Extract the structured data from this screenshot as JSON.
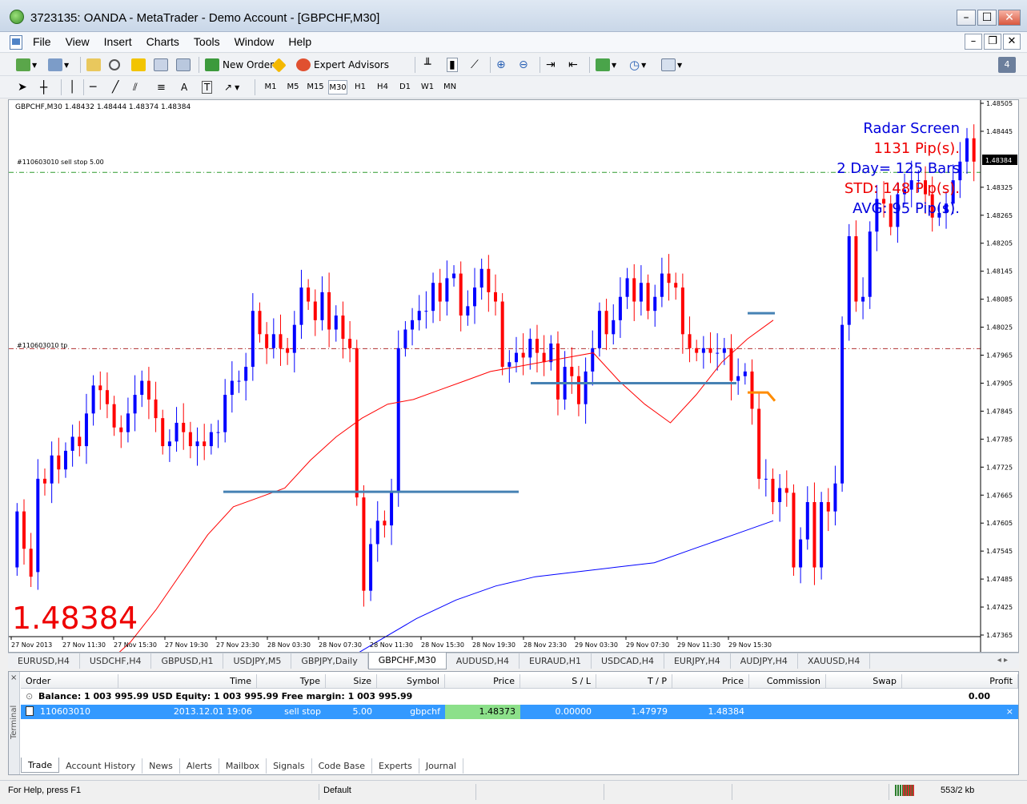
{
  "window": {
    "title": "3723135: OANDA - MetaTrader - Demo Account - [GBPCHF,M30]"
  },
  "menu": [
    "File",
    "View",
    "Insert",
    "Charts",
    "Tools",
    "Window",
    "Help"
  ],
  "toolbar": {
    "new_order": "New Order",
    "expert_advisors": "Expert Advisors",
    "notify_count": "4",
    "draw_text_tool": "A",
    "timeframes": [
      "M1",
      "M5",
      "M15",
      "M30",
      "H1",
      "H4",
      "D1",
      "W1",
      "MN"
    ],
    "active_timeframe": "M30"
  },
  "chart": {
    "header": "GBPCHF,M30  1.48432 1.48444 1.48374 1.48384",
    "price_big": "1.48384",
    "current_price_label": "1.48384",
    "order_line_label": "#110603010 sell stop 5.00",
    "tp_line_label": "#110603010 tp",
    "radar": {
      "title": "Radar Screen",
      "pips": "1131 Pip(s).",
      "bars": "2 Day= 125 Bars",
      "std": "STD: 148 Pip(s).",
      "avg": "AVG: 95 Pip(s)."
    },
    "colors": {
      "bull": "#0000ff",
      "bear": "#ff0000",
      "ma_fast": "#ff0000",
      "ma_slow": "#0000ff",
      "level": "#4682b4",
      "orange": "#ff8c00"
    }
  },
  "chart_data": {
    "type": "candlestick",
    "symbol": "GBPCHF",
    "timeframe": "M30",
    "ylim": [
      1.47365,
      1.48505
    ],
    "y_ticks": [
      "1.48505",
      "1.48445",
      "1.48325",
      "1.48265",
      "1.48205",
      "1.48145",
      "1.48085",
      "1.48025",
      "1.47965",
      "1.47905",
      "1.47845",
      "1.47785",
      "1.47725",
      "1.47665",
      "1.47605",
      "1.47545",
      "1.47485",
      "1.47425",
      "1.47365"
    ],
    "x_ticks": [
      "27 Nov 2013",
      "27 Nov 11:30",
      "27 Nov 15:30",
      "27 Nov 19:30",
      "27 Nov 23:30",
      "28 Nov 03:30",
      "28 Nov 07:30",
      "28 Nov 11:30",
      "28 Nov 15:30",
      "28 Nov 19:30",
      "28 Nov 23:30",
      "29 Nov 03:30",
      "29 Nov 07:30",
      "29 Nov 11:30",
      "29 Nov 15:30"
    ],
    "close_series": [
      1.4763,
      1.4755,
      1.4749,
      1.477,
      1.4769,
      1.4775,
      1.4772,
      1.4776,
      1.4779,
      1.4777,
      1.4784,
      1.479,
      1.4789,
      1.4786,
      1.4781,
      1.478,
      1.4784,
      1.4788,
      1.4791,
      1.4787,
      1.4783,
      1.4777,
      1.4778,
      1.4782,
      1.478,
      1.4777,
      1.4778,
      1.4777,
      1.478,
      1.478,
      1.4788,
      1.4791,
      1.4791,
      1.4794,
      1.4806,
      1.4801,
      1.4798,
      1.4801,
      1.4798,
      1.4797,
      1.4803,
      1.4811,
      1.4808,
      1.4804,
      1.481,
      1.4802,
      1.4805,
      1.48,
      1.4798,
      1.4766,
      1.4746,
      1.4756,
      1.4761,
      1.476,
      1.4767,
      1.4798,
      1.4802,
      1.4804,
      1.4806,
      1.4806,
      1.4812,
      1.4808,
      1.4813,
      1.4814,
      1.4805,
      1.4807,
      1.4811,
      1.4815,
      1.481,
      1.4808,
      1.4794,
      1.4795,
      1.4797,
      1.4796,
      1.48,
      1.4797,
      1.4795,
      1.4799,
      1.4787,
      1.4794,
      1.4792,
      1.4786,
      1.4793,
      1.4798,
      1.4806,
      1.4801,
      1.4804,
      1.4809,
      1.4813,
      1.4808,
      1.4812,
      1.4806,
      1.4809,
      1.4814,
      1.4812,
      1.4811,
      1.4801,
      1.4798,
      1.4797,
      1.4798,
      1.4797,
      1.4797,
      1.4798,
      1.4791,
      1.4792,
      1.4793,
      1.4785,
      1.477,
      1.477,
      1.4765,
      1.4768,
      1.4767,
      1.4751,
      1.4757,
      1.4765,
      1.4751,
      1.4765,
      1.4763,
      1.4769,
      1.4803,
      1.4822,
      1.4808,
      1.4809,
      1.4823,
      1.483,
      1.4829,
      1.4824,
      1.4831,
      1.4832,
      1.4834,
      1.4834,
      1.4831,
      1.4826,
      1.4827,
      1.4829,
      1.4834,
      1.4838,
      1.4843,
      1.4838
    ],
    "open_series": [
      1.4751,
      1.4763,
      1.4755,
      1.475,
      1.477,
      1.4769,
      1.4775,
      1.4772,
      1.4776,
      1.4779,
      1.4777,
      1.4784,
      1.479,
      1.4789,
      1.4786,
      1.4781,
      1.478,
      1.4784,
      1.4788,
      1.4791,
      1.4787,
      1.4783,
      1.4777,
      1.4778,
      1.4782,
      1.478,
      1.4777,
      1.4778,
      1.4777,
      1.478,
      1.478,
      1.4788,
      1.4791,
      1.4791,
      1.4794,
      1.4806,
      1.4801,
      1.4798,
      1.4801,
      1.4798,
      1.4797,
      1.4803,
      1.4811,
      1.4808,
      1.4804,
      1.481,
      1.4802,
      1.4805,
      1.48,
      1.4798,
      1.4766,
      1.4746,
      1.4756,
      1.4761,
      1.476,
      1.4767,
      1.4798,
      1.4802,
      1.4804,
      1.4806,
      1.4806,
      1.4812,
      1.4808,
      1.4813,
      1.4814,
      1.4805,
      1.4807,
      1.4811,
      1.4815,
      1.481,
      1.4808,
      1.4794,
      1.4795,
      1.4797,
      1.4796,
      1.48,
      1.4797,
      1.4795,
      1.4799,
      1.4787,
      1.4794,
      1.4792,
      1.4786,
      1.4793,
      1.4798,
      1.4806,
      1.4801,
      1.4804,
      1.4809,
      1.4813,
      1.4808,
      1.4812,
      1.4806,
      1.4809,
      1.4814,
      1.4812,
      1.4811,
      1.4801,
      1.4798,
      1.4797,
      1.4798,
      1.4797,
      1.4797,
      1.4798,
      1.4791,
      1.4792,
      1.4793,
      1.4785,
      1.477,
      1.477,
      1.4765,
      1.4768,
      1.4767,
      1.4751,
      1.4757,
      1.4765,
      1.4751,
      1.4765,
      1.4763,
      1.4769,
      1.4803,
      1.4822,
      1.4808,
      1.4809,
      1.4823,
      1.483,
      1.4829,
      1.4824,
      1.4831,
      1.4832,
      1.4834,
      1.4834,
      1.4831,
      1.4826,
      1.4827,
      1.4829,
      1.4834,
      1.4838,
      1.4843
    ],
    "ma_fast": [
      1.473,
      1.4735,
      1.4742,
      1.475,
      1.4758,
      1.4764,
      1.4766,
      1.4768,
      1.4774,
      1.4779,
      1.4783,
      1.4786,
      1.4787,
      1.4789,
      1.4791,
      1.4793,
      1.4794,
      1.4795,
      1.4796,
      1.4797,
      1.4791,
      1.4786,
      1.4782,
      1.4788,
      1.4795,
      1.48,
      1.4804
    ],
    "ma_slow": [
      1.473,
      1.4735,
      1.474,
      1.4744,
      1.4747,
      1.4749,
      1.475,
      1.4751,
      1.4752,
      1.4755,
      1.4758,
      1.4761
    ],
    "levels": [
      {
        "name": "sell stop",
        "price": 1.48357
      },
      {
        "name": "tp",
        "price": 1.47979
      }
    ]
  },
  "symbol_tabs": [
    "EURUSD,H4",
    "USDCHF,H4",
    "GBPUSD,H1",
    "USDJPY,M5",
    "GBPJPY,Daily",
    "GBPCHF,M30",
    "AUDUSD,H4",
    "EURAUD,H1",
    "USDCAD,H4",
    "EURJPY,H4",
    "AUDJPY,H4",
    "XAUUSD,H4"
  ],
  "active_symbol_tab": "GBPCHF,M30",
  "terminal": {
    "side_label": "Terminal",
    "close_glyph": "×",
    "columns": [
      "Order",
      "Time",
      "Type",
      "Size",
      "Symbol",
      "Price",
      "S / L",
      "T / P",
      "Price",
      "Commission",
      "Swap",
      "Profit"
    ],
    "balance_text": "Balance: 1 003 995.99 USD  Equity: 1 003 995.99  Free margin: 1 003 995.99",
    "balance_profit": "0.00",
    "order": {
      "id": "110603010",
      "time": "2013.12.01 19:06",
      "type": "sell stop",
      "size": "5.00",
      "symbol": "gbpchf",
      "price": "1.48373",
      "sl": "0.00000",
      "tp": "1.47979",
      "cur_price": "1.48384",
      "close": "×"
    },
    "tabs": [
      "Trade",
      "Account History",
      "News",
      "Alerts",
      "Mailbox",
      "Signals",
      "Code Base",
      "Experts",
      "Journal"
    ],
    "active_tab": "Trade"
  },
  "status": {
    "help": "For Help, press F1",
    "profile": "Default",
    "traffic": "553/2 kb"
  }
}
